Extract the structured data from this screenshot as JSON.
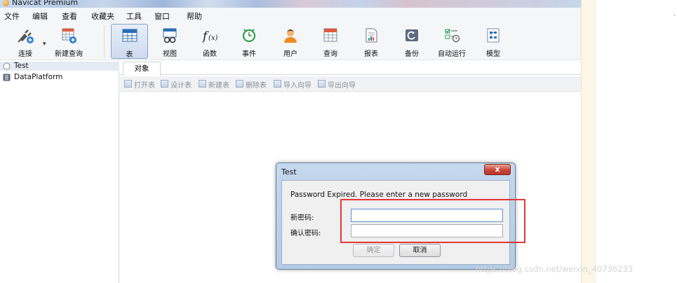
{
  "window": {
    "title": "Navicat Premium"
  },
  "menu": [
    "文件",
    "编辑",
    "查看",
    "收藏夹",
    "工具",
    "窗口",
    "帮助"
  ],
  "toolbar": {
    "items": [
      {
        "label": "连接",
        "icon": "plug-icon"
      },
      {
        "label": "新建查询",
        "icon": "new-query-icon"
      },
      {
        "label": "表",
        "icon": "table-icon"
      },
      {
        "label": "视图",
        "icon": "view-icon"
      },
      {
        "label": "函数",
        "icon": "function-icon"
      },
      {
        "label": "事件",
        "icon": "clock-icon"
      },
      {
        "label": "用户",
        "icon": "user-icon"
      },
      {
        "label": "查询",
        "icon": "query-icon"
      },
      {
        "label": "报表",
        "icon": "report-icon"
      },
      {
        "label": "备份",
        "icon": "backup-icon"
      },
      {
        "label": "自动运行",
        "icon": "schedule-icon"
      },
      {
        "label": "模型",
        "icon": "model-icon"
      }
    ],
    "active_index": 2
  },
  "sidebar": {
    "items": [
      {
        "label": "Test",
        "icon": "connection-icon"
      },
      {
        "label": "DataPlatform",
        "icon": "database-icon"
      }
    ]
  },
  "content": {
    "tab": "对象",
    "object_actions": [
      "打开表",
      "设计表",
      "新建表",
      "删除表",
      "导入向导",
      "导出向导"
    ]
  },
  "dialog": {
    "title": "Test",
    "close_label": "x",
    "message": "Password Expired. Please enter a new password",
    "new_password_label": "新密码:",
    "confirm_password_label": "确认密码:",
    "new_password_value": "",
    "confirm_password_value": "",
    "ok_label": "确定",
    "cancel_label": "取消"
  },
  "watermark": "https://blog.csdn.net/weixin_40736233",
  "colors": {
    "highlight": "#e23838",
    "close_button": "#c8463a"
  }
}
